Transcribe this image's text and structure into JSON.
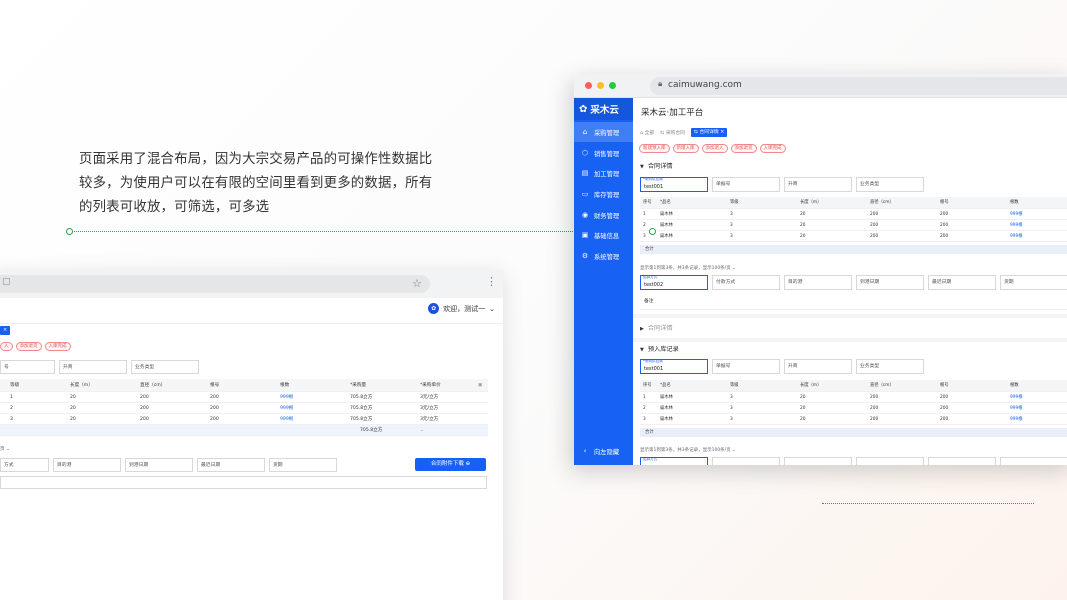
{
  "description": {
    "line1": "页面采用了混合布局，因为大宗交易产品的可操作性数据比",
    "line2": "较多，为使用户可以在有限的空间里看到更多的数据，所有",
    "line3": "的列表可收放，可筛选，可多选"
  },
  "back_window": {
    "user_greeting": "欢迎，测试一",
    "tab_close": "×",
    "chips": [
      "入",
      "添加退货",
      "入库完成"
    ],
    "fields": [
      "号",
      "升商",
      "业务类型"
    ],
    "table": {
      "headers": [
        "等级",
        "长度（m）",
        "直径（cm）",
        "根号",
        "根数",
        "*采购量",
        "*采购单价"
      ],
      "rows": [
        [
          "1",
          "20",
          "200",
          "200",
          "999根",
          "705.8立方",
          "3元/立方"
        ],
        [
          "2",
          "20",
          "200",
          "200",
          "999根",
          "705.8立方",
          "3元/立方"
        ],
        [
          "3",
          "20",
          "200",
          "200",
          "999根",
          "705.8立方",
          "3元/立方"
        ]
      ],
      "total": "705.8立方"
    },
    "pagination": "页",
    "fields2": [
      "方式",
      "目的港",
      "到港日期",
      "最迟日期",
      "货期"
    ],
    "download_button": "合同附件下载"
  },
  "front_window": {
    "url": "caimuwang.com",
    "logo": "采木云",
    "nav": [
      "采购管理",
      "销售管理",
      "加工管理",
      "库存管理",
      "财务管理",
      "基础信息",
      "系统管理"
    ],
    "collapse_label": "向左隐藏",
    "title": "采木云·加工平台",
    "breadcrumb": {
      "home": "全部",
      "purchase": "采购合同",
      "active_tab": "合同详情",
      "close": "×"
    },
    "chips": [
      "新建预入库",
      "新增入库",
      "添加退入",
      "添加退货",
      "入库完成"
    ],
    "section1": {
      "title": "合同详情",
      "fields": [
        {
          "label": "*采购供应商",
          "value": "test001"
        },
        {
          "label": "",
          "value": "单据号"
        },
        {
          "label": "",
          "value": "升商"
        },
        {
          "label": "",
          "value": "业务类型"
        }
      ],
      "headers": [
        "序号",
        "*品名",
        "等级",
        "长度（m）",
        "直径（cm）",
        "根号",
        "根数"
      ],
      "rows": [
        [
          "1",
          "扁木林",
          "3",
          "20",
          "200",
          "200",
          "999根"
        ],
        [
          "2",
          "扁木林",
          "3",
          "20",
          "200",
          "200",
          "999根"
        ],
        [
          "3",
          "扁木林",
          "3",
          "20",
          "200",
          "200",
          "999根"
        ]
      ],
      "total": "合计",
      "pagination": "显示第1到第3条，共3条记录，显示100条/页",
      "fields2": [
        {
          "label": "结算方式",
          "value": "test002"
        },
        {
          "label": "",
          "value": "付款方式"
        },
        {
          "label": "",
          "value": "目的港"
        },
        {
          "label": "",
          "value": "到港日期"
        },
        {
          "label": "",
          "value": "最迟日期"
        },
        {
          "label": "",
          "value": "货期"
        }
      ],
      "memo": "备注"
    },
    "section_collapsed": "合同详情",
    "section2": {
      "title": "预入库记录",
      "fields": [
        {
          "label": "*采购供应商",
          "value": "test001"
        },
        {
          "label": "",
          "value": "单据号"
        },
        {
          "label": "",
          "value": "升商"
        },
        {
          "label": "",
          "value": "业务类型"
        }
      ],
      "headers": [
        "序号",
        "*品名",
        "等级",
        "长度（m）",
        "直径（cm）",
        "根号",
        "根数"
      ],
      "rows": [
        [
          "1",
          "扁木林",
          "3",
          "20",
          "200",
          "200",
          "999根"
        ],
        [
          "2",
          "扁木林",
          "3",
          "20",
          "200",
          "200",
          "999根"
        ],
        [
          "3",
          "扁木林",
          "3",
          "20",
          "200",
          "200",
          "999根"
        ]
      ],
      "total": "合计",
      "pagination": "显示第1到第3条，共3条记录，显示100条/页",
      "next_field_label": "结算方式"
    }
  }
}
